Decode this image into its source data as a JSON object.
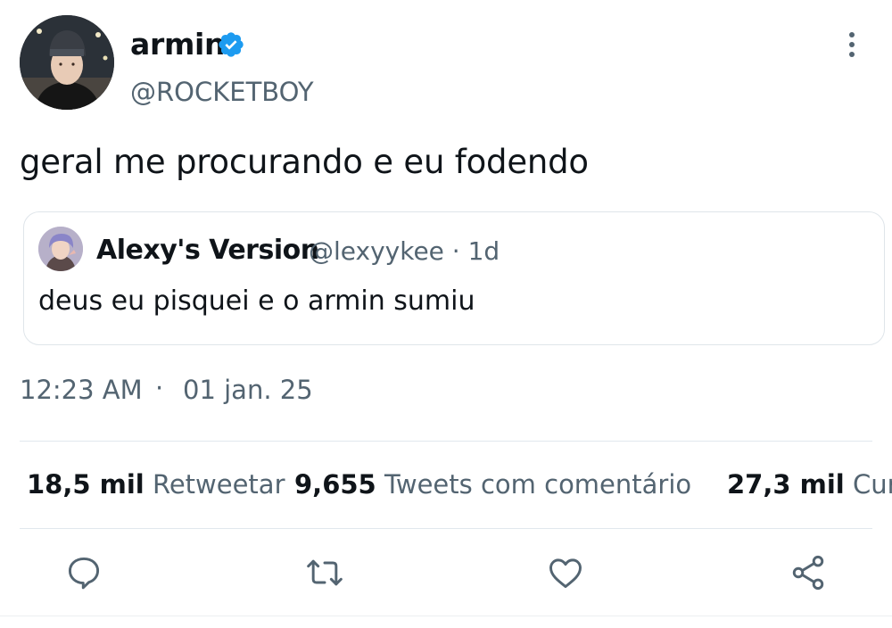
{
  "author": {
    "display_name": "armin",
    "handle": "@ROCKETBOY",
    "verified": true
  },
  "tweet": {
    "text": "geral me procurando e eu fodendo",
    "time": "12:23 AM",
    "separator": "·",
    "date": "01 jan. 25"
  },
  "quoted_tweet": {
    "display_name": "Alexy's Version",
    "handle_time": "@lexyykee · 1d",
    "text": "deus eu pisquei e o armin sumiu"
  },
  "stats": {
    "retweets": {
      "count": "18,5 mil",
      "label": "Retweetar"
    },
    "quotes": {
      "count": "9,655",
      "label": "Tweets com comentário"
    },
    "likes": {
      "count": "27,3 mil",
      "label": "Curtidas"
    }
  },
  "actions": [
    "reply-icon",
    "retweet-icon",
    "like-icon",
    "share-icon"
  ],
  "colors": {
    "text": "#0f1419",
    "secondary": "#536471",
    "verified": "#1d9bf0",
    "border": "#dfe5ea"
  }
}
